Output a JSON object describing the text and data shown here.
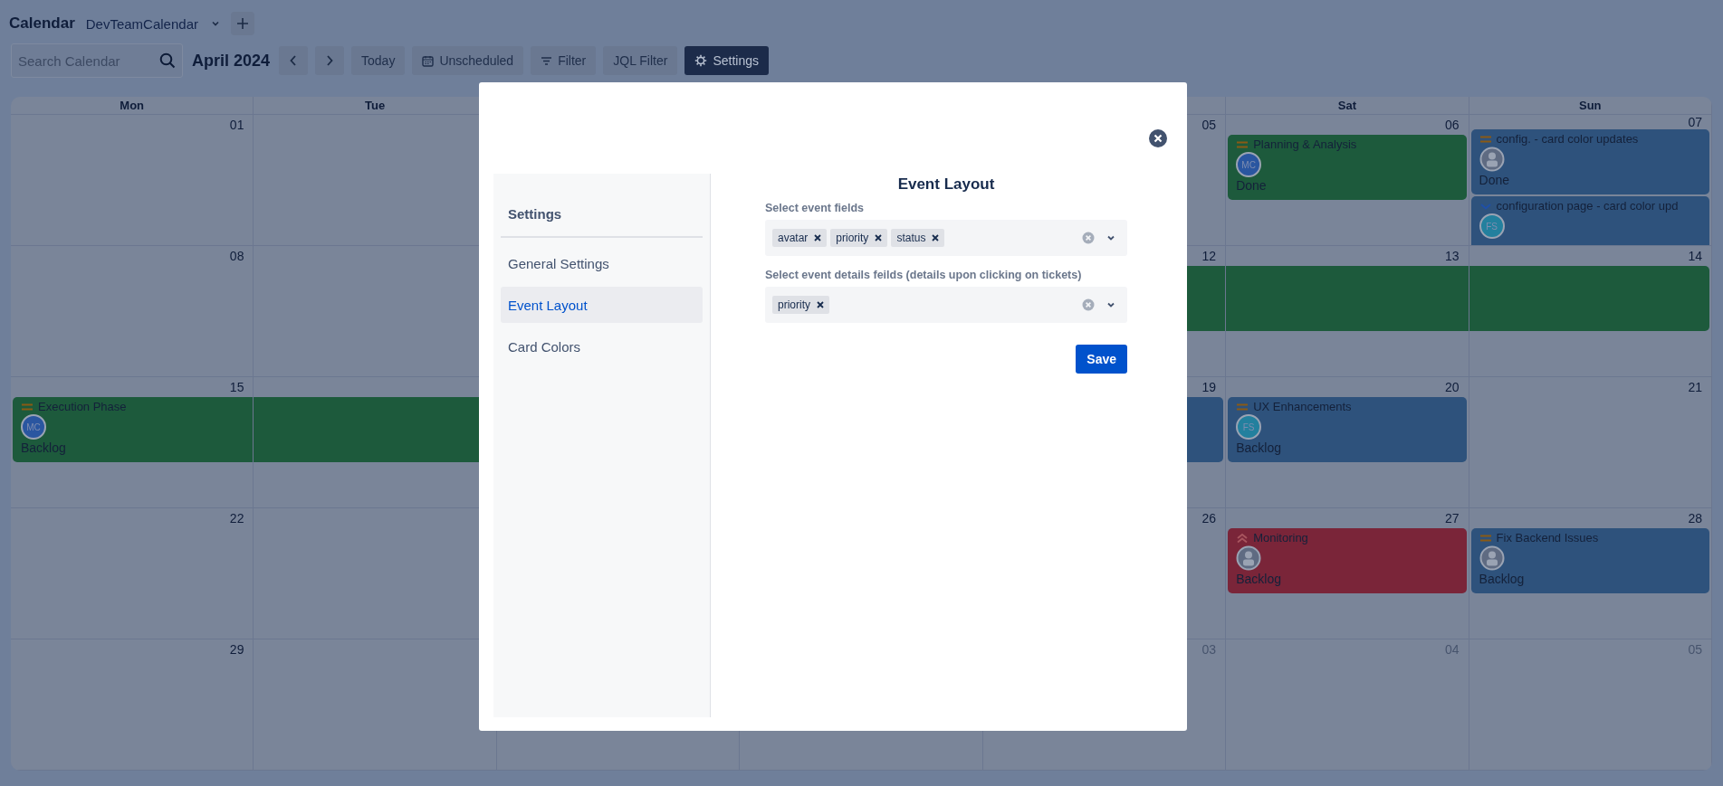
{
  "header": {
    "title": "Calendar",
    "calendar_name": "DevTeamCalendar"
  },
  "toolbar": {
    "search": {
      "placeholder": "Search Calendar"
    },
    "month": "April 2024",
    "buttons": [
      {
        "label": "Today",
        "kind": "plain",
        "selected": false
      },
      {
        "label": "Unscheduled",
        "kind": "calendar",
        "selected": false
      },
      {
        "label": "Filter",
        "kind": "filter",
        "selected": false
      },
      {
        "label": "JQL Filter",
        "kind": "plain",
        "selected": false
      },
      {
        "label": "Settings",
        "kind": "settings",
        "selected": true
      }
    ]
  },
  "calendar": {
    "weekdays": {
      "mon": "Mon",
      "tue": "Tue",
      "sat": "Sat",
      "sun": "Sun"
    },
    "weeks": [
      {
        "mon": {
          "date": "01",
          "outside": false
        },
        "fri": {
          "date": "05",
          "outside": false
        },
        "sat": {
          "date": "06",
          "outside": false,
          "events": [
            {
              "title": "Planning & Analysis",
              "priority": {
                "kind": "medium"
              },
              "avatar": {
                "kind": "initials",
                "initials": "MC",
                "color": "#2a56a0"
              },
              "status": "Done",
              "color": "#1d5a3c",
              "continued": false,
              "continues": false
            }
          ]
        },
        "sun": {
          "date": "07",
          "outside": false,
          "events": [
            {
              "title": "config. - card color updates",
              "priority": {
                "kind": "medium"
              },
              "avatar": {
                "kind": "default"
              },
              "status": "Done",
              "color": "#2e527c",
              "continued": false,
              "continues": false
            },
            {
              "title": "configuration page - card color upd",
              "priority": {
                "kind": "low"
              },
              "avatar": {
                "kind": "initials",
                "initials": "FS",
                "color": "#23809e"
              },
              "color": "#2e527c",
              "continued": false,
              "continues": false
            }
          ]
        }
      },
      {
        "mon": {
          "date": "08",
          "outside": false
        },
        "fri": {
          "date": "12",
          "outside": false,
          "events": [
            {
              "color": "#1d5a3c",
              "continued": true,
              "continues": true
            }
          ]
        },
        "sat": {
          "date": "13",
          "outside": false,
          "events": [
            {
              "color": "#1d5a3c",
              "continued": true,
              "continues": true
            }
          ]
        },
        "sun": {
          "date": "14",
          "outside": false,
          "events": [
            {
              "color": "#1d5a3c",
              "continued": true,
              "continues": false
            }
          ]
        }
      },
      {
        "mon": {
          "date": "15",
          "outside": false,
          "events": [
            {
              "title": "Execution Phase",
              "priority": {
                "kind": "medium"
              },
              "avatar": {
                "kind": "initials",
                "initials": "MC",
                "color": "#2a56a0"
              },
              "status": "Backlog",
              "color": "#1d5a3c",
              "continued": false,
              "continues": true
            }
          ]
        },
        "tue": {
          "events": [
            {
              "color": "#1d5a3c",
              "continued": true,
              "continues": true
            }
          ]
        },
        "fri": {
          "date": "19",
          "outside": false,
          "events": [
            {
              "color": "#2e527c",
              "continued": true,
              "continues": false
            }
          ]
        },
        "sat": {
          "date": "20",
          "outside": false,
          "events": [
            {
              "title": "UX Enhancements",
              "priority": {
                "kind": "medium"
              },
              "avatar": {
                "kind": "initials",
                "initials": "FS",
                "color": "#23809e"
              },
              "status": "Backlog",
              "color": "#2e527c",
              "continued": false,
              "continues": false
            }
          ]
        },
        "sun": {
          "date": "21",
          "outside": false
        }
      },
      {
        "mon": {
          "date": "22",
          "outside": false
        },
        "fri": {
          "date": "26",
          "outside": false
        },
        "sat": {
          "date": "27",
          "outside": false,
          "events": [
            {
              "title": "Monitoring",
              "priority": {
                "kind": "highest"
              },
              "avatar": {
                "kind": "default"
              },
              "status": "Backlog",
              "color": "#7a2539",
              "continued": false,
              "continues": false
            }
          ]
        },
        "sun": {
          "date": "28",
          "outside": false,
          "events": [
            {
              "title": "Fix Backend Issues",
              "priority": {
                "kind": "medium"
              },
              "avatar": {
                "kind": "default"
              },
              "status": "Backlog",
              "color": "#2e527c",
              "continued": false,
              "continues": false
            }
          ]
        }
      },
      {
        "mon": {
          "date": "29",
          "outside": false
        },
        "fri": {
          "date": "03",
          "outside": true
        },
        "sat": {
          "date": "04",
          "outside": true
        },
        "sun": {
          "date": "05",
          "outside": true
        }
      }
    ]
  },
  "settings_dialog": {
    "sidebar": {
      "title": "Settings",
      "items": [
        {
          "label": "General Settings",
          "selected": false
        },
        {
          "label": "Event Layout",
          "selected": true
        },
        {
          "label": "Card Colors",
          "selected": false
        }
      ]
    },
    "content": {
      "title": "Event Layout",
      "fields": [
        {
          "label": "Select event fields",
          "tags": [
            "avatar",
            "priority",
            "status"
          ]
        },
        {
          "label": "Select event details feilds (details upon clicking on tickets)",
          "tags": [
            "priority"
          ]
        }
      ],
      "save": "Save"
    }
  }
}
